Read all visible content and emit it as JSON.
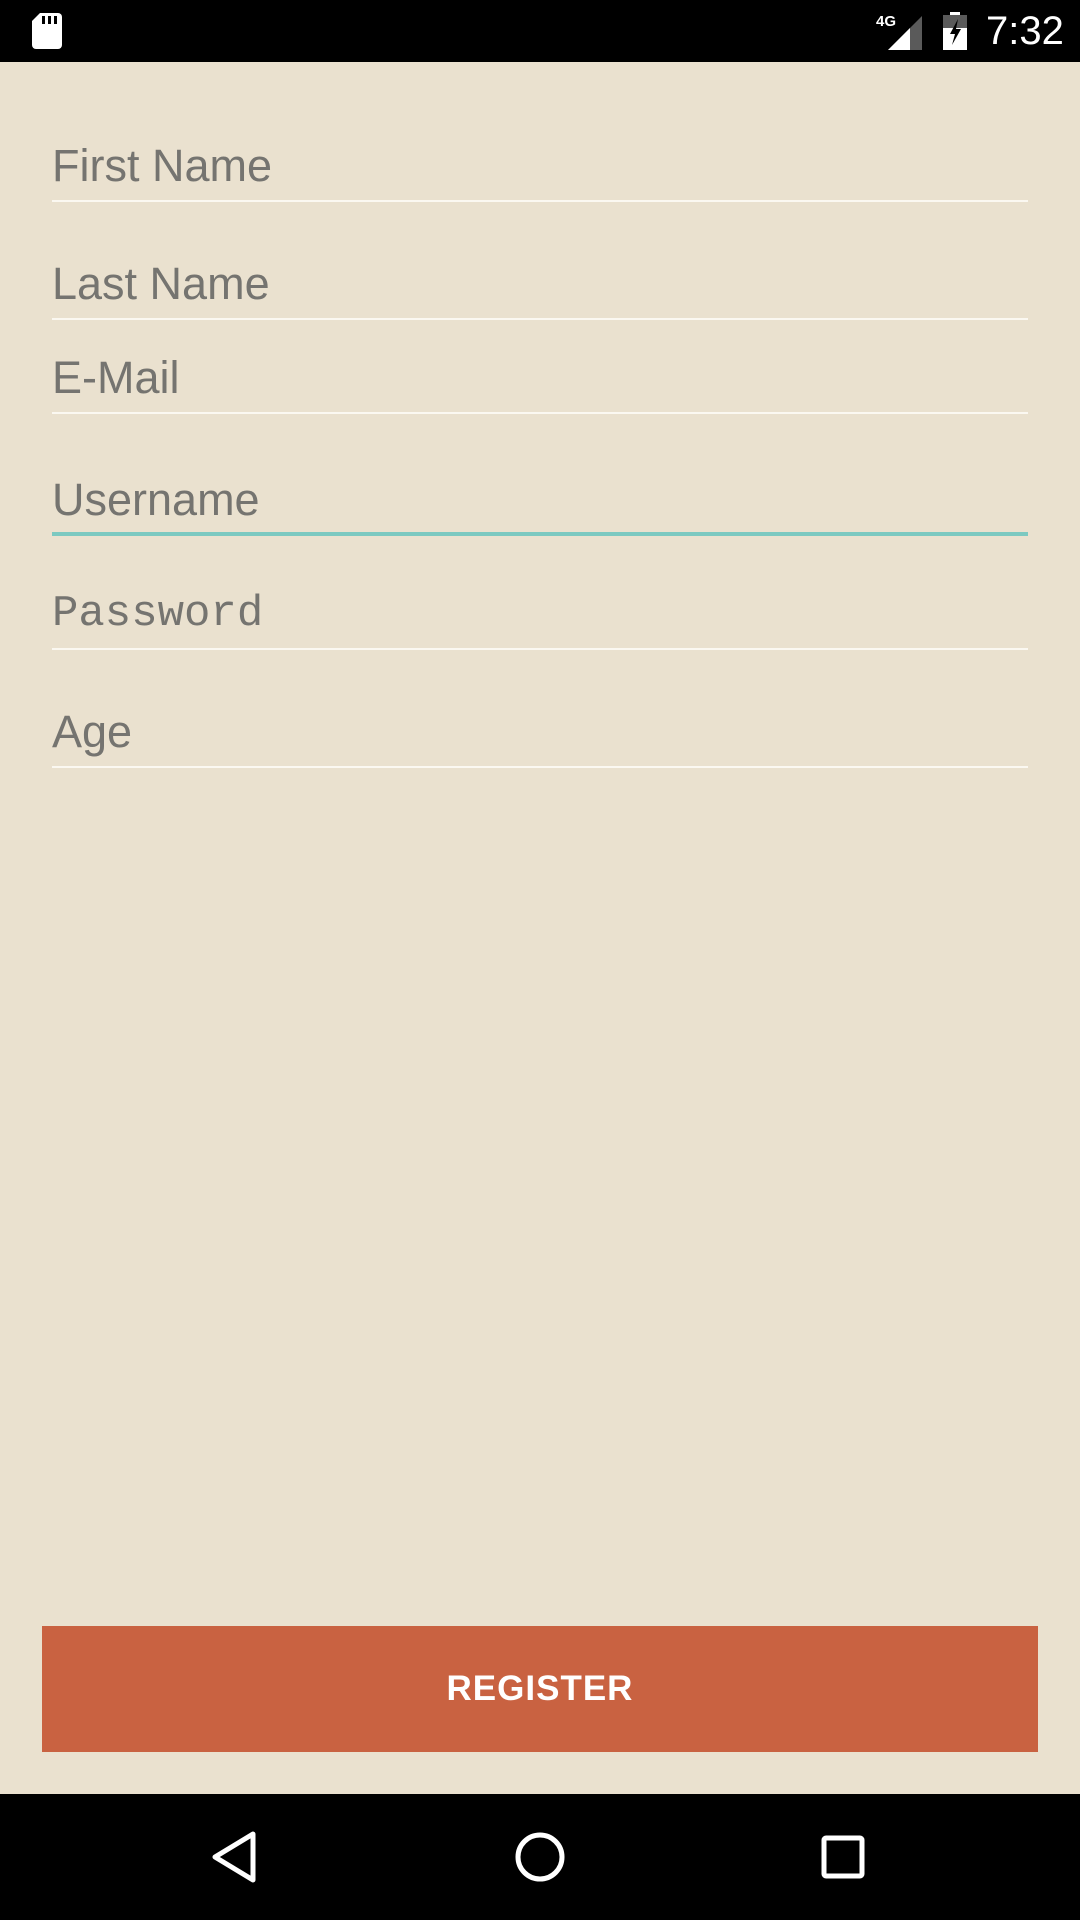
{
  "status_bar": {
    "time": "7:32",
    "network_label": "4G",
    "icons": [
      "sd-card-icon",
      "cellular-signal-icon",
      "battery-charging-icon"
    ]
  },
  "form": {
    "fields": [
      {
        "id": "first_name",
        "placeholder": "First Name",
        "focused": false,
        "type": "text"
      },
      {
        "id": "last_name",
        "placeholder": "Last Name",
        "focused": false,
        "type": "text"
      },
      {
        "id": "email",
        "placeholder": "E-Mail",
        "focused": false,
        "type": "email"
      },
      {
        "id": "username",
        "placeholder": "Username",
        "focused": true,
        "type": "text"
      },
      {
        "id": "password",
        "placeholder": "Password",
        "focused": false,
        "type": "password"
      },
      {
        "id": "age",
        "placeholder": "Age",
        "focused": false,
        "type": "number"
      }
    ]
  },
  "register_button": {
    "label": "REGISTER"
  },
  "nav_bar": {
    "icons": [
      "back-icon",
      "home-icon",
      "recents-icon"
    ]
  },
  "colors": {
    "background": "#EAE1CF",
    "accent": "#7CC9C1",
    "button": "#C96241",
    "hint_text": "#757470"
  }
}
